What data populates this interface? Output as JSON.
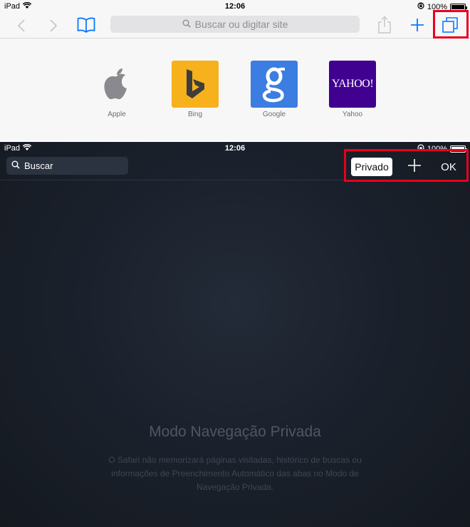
{
  "top_panel": {
    "status": {
      "carrier": "iPad",
      "time": "12:06",
      "battery": "100%"
    },
    "toolbar": {
      "search_placeholder": "Buscar ou digitar site",
      "accent": "#0a7aff",
      "highlight_color": "#e8001c"
    },
    "favorites": [
      {
        "label": "Apple",
        "icon": "apple-logo-icon",
        "bg": "#ffffff"
      },
      {
        "label": "Bing",
        "icon": "bing-logo-icon",
        "bg": "#f7b11d"
      },
      {
        "label": "Google",
        "icon": "google-logo-icon",
        "bg": "#3b7de0"
      },
      {
        "label": "Yahoo",
        "icon": "yahoo-logo-icon",
        "bg": "#400090",
        "logo_text": "YAHOO!"
      }
    ]
  },
  "bottom_panel": {
    "status": {
      "carrier": "iPad",
      "time": "12:06",
      "battery": "100%"
    },
    "search_placeholder": "Buscar",
    "buttons": {
      "private": "Privado",
      "done": "OK"
    },
    "private_mode": {
      "title": "Modo Navegação Privada",
      "description": "O Safari não memorizará páginas visitadas, histórico de buscas ou informações de Preenchimento Automático das abas no Modo de Navegação Privada."
    }
  }
}
